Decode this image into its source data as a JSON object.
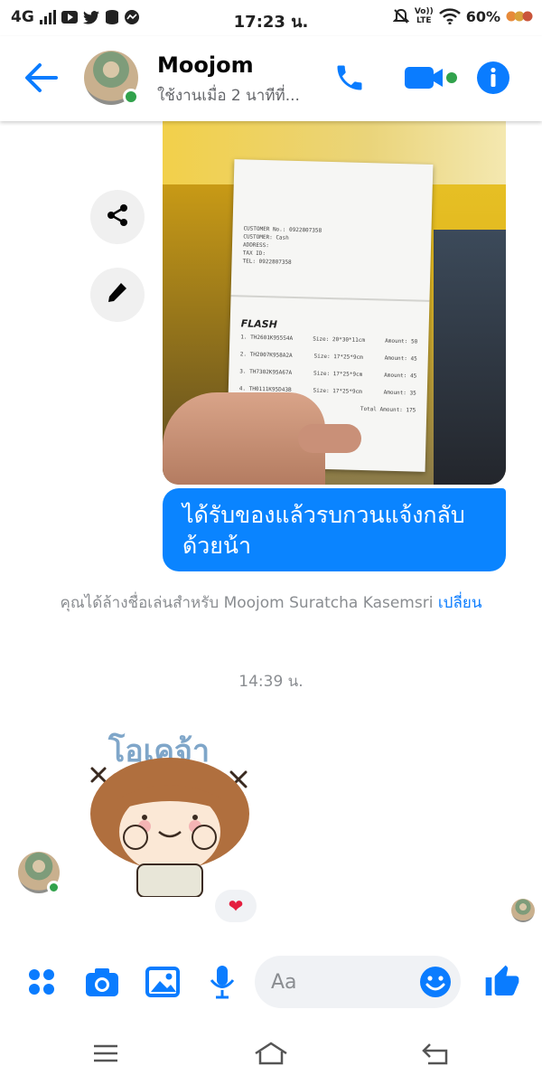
{
  "status_bar": {
    "network": "4G",
    "time": "17:23 น.",
    "volte_top": "Vo))",
    "volte_bottom": "LTE",
    "battery": "60%"
  },
  "header": {
    "contact_name": "Moojom",
    "contact_status": "ใช้งานเมื่อ 2 นาทีที่...",
    "icons": [
      "back-arrow-icon",
      "phone-icon",
      "video-icon",
      "info-icon"
    ],
    "accent": "#0a7cff",
    "online_color": "#31a24c"
  },
  "chat": {
    "outgoing_text_line1": "ได้รับของแล้วรบกวนแจ้งกลับ",
    "outgoing_text_line2": "ด้วยน้า",
    "outgoing_color": "#0a84ff",
    "receipt": {
      "logo": "FLASH",
      "customer_no": "CUSTOMER No.: 0922807358",
      "customer": "CUSTOMER: Cash",
      "address": "ADDRESS:",
      "tax_id": "TAX ID:",
      "tel": "TEL: 0922807358",
      "items": [
        {
          "code": "1. TH2601K955S4A",
          "size": "Size: 20*30*11cm",
          "amount": "Amount: 50"
        },
        {
          "code": "2. TH2007K958A2A",
          "size": "Size: 17*25*9cm",
          "amount": "Amount: 45"
        },
        {
          "code": "3. TH7302K95A67A",
          "size": "Size: 17*25*9cm",
          "amount": "Amount: 45"
        },
        {
          "code": "4. TH0111K95D43B",
          "size": "Size: 17*25*9cm",
          "amount": "Amount: 35"
        }
      ],
      "total": "Total Amount: 175"
    },
    "notice_text": "คุณได้ล้างชื่อเล่นสำหรับ Moojom Suratcha Kasemsri",
    "notice_link": "เปลี่ยน",
    "timestamp": "14:39 น.",
    "sticker_text": "โอเคจ้า",
    "reaction": "❤"
  },
  "composer": {
    "placeholder": "Aa",
    "icons": [
      "apps-icon",
      "camera-icon",
      "image-icon",
      "microphone-icon",
      "emoji-icon",
      "thumbs-up-icon"
    ]
  }
}
